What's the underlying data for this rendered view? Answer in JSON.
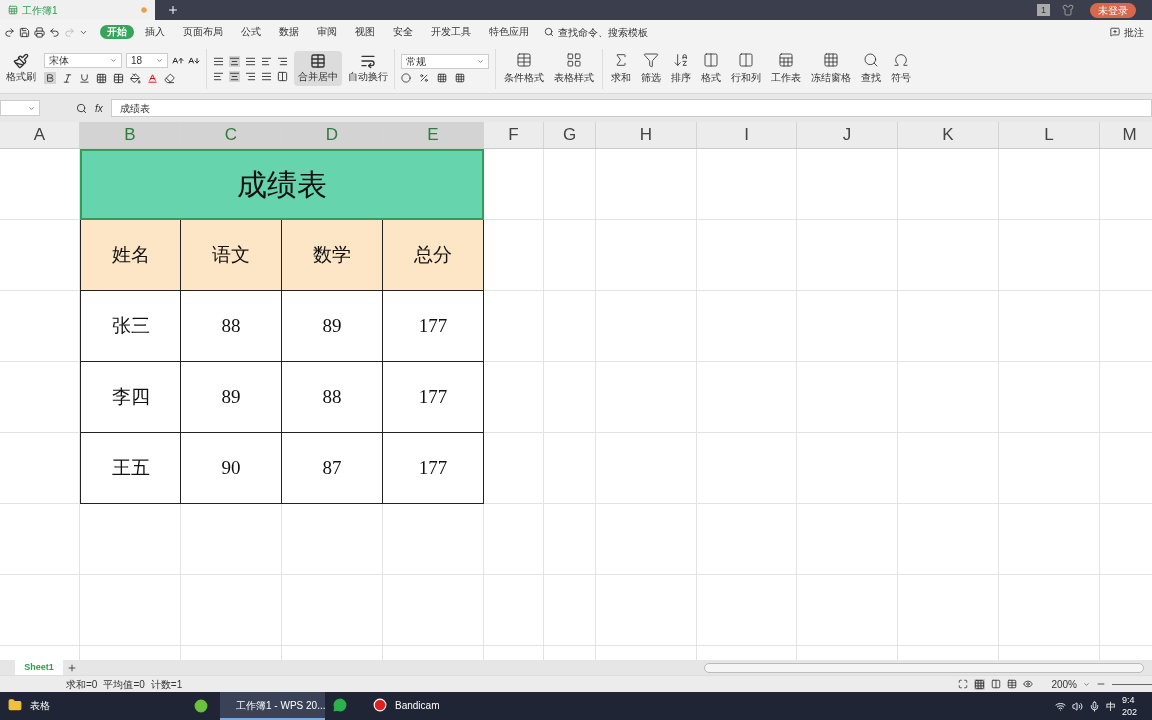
{
  "title_bar": {
    "tabs": [
      {
        "label": "工作簿1",
        "selected": true
      }
    ],
    "window_count": "1",
    "login": "未登录"
  },
  "menu": {
    "items": [
      {
        "label": "开始",
        "selected": true
      },
      {
        "label": "插入",
        "selected": false
      },
      {
        "label": "页面布局",
        "selected": false
      },
      {
        "label": "公式",
        "selected": false
      },
      {
        "label": "数据",
        "selected": false
      },
      {
        "label": "审阅",
        "selected": false
      },
      {
        "label": "视图",
        "selected": false
      },
      {
        "label": "安全",
        "selected": false
      },
      {
        "label": "开发工具",
        "selected": false
      },
      {
        "label": "特色应用",
        "selected": false
      }
    ],
    "search": "查找命令、搜索模板",
    "comment": "批注"
  },
  "ribbon": {
    "format_painter": "格式刷",
    "font_name": "宋体",
    "font_size": "18",
    "bold": true,
    "align_center": true,
    "merge": "合并居中",
    "wrap": "自动换行",
    "number_format": "常规",
    "tools": [
      {
        "kind": "cond",
        "label": "条件格式"
      },
      {
        "kind": "style",
        "label": "表格样式"
      },
      {
        "kind": "sum",
        "label": "求和"
      },
      {
        "kind": "filter",
        "label": "筛选"
      },
      {
        "kind": "sort",
        "label": "排序"
      },
      {
        "kind": "format",
        "label": "格式"
      },
      {
        "kind": "rowcol",
        "label": "行和列"
      },
      {
        "kind": "sheet",
        "label": "工作表"
      },
      {
        "kind": "freeze",
        "label": "冻结窗格"
      },
      {
        "kind": "find",
        "label": "查找"
      },
      {
        "kind": "symbol",
        "label": "符号"
      }
    ]
  },
  "formula_bar": {
    "fx": "fx",
    "value": "成绩表"
  },
  "columns": [
    {
      "label": "A",
      "selected": false
    },
    {
      "label": "B",
      "selected": true
    },
    {
      "label": "C",
      "selected": true
    },
    {
      "label": "D",
      "selected": true
    },
    {
      "label": "E",
      "selected": true
    },
    {
      "label": "F",
      "selected": false
    },
    {
      "label": "G",
      "selected": false
    },
    {
      "label": "H",
      "selected": false
    },
    {
      "label": "I",
      "selected": false
    },
    {
      "label": "J",
      "selected": false
    },
    {
      "label": "K",
      "selected": false
    },
    {
      "label": "L",
      "selected": false
    },
    {
      "label": "M",
      "selected": false
    }
  ],
  "table": {
    "title": "成绩表",
    "headers": [
      "姓名",
      "语文",
      "数学",
      "总分"
    ],
    "rows": [
      [
        "张三",
        "88",
        "89",
        "177"
      ],
      [
        "李四",
        "89",
        "88",
        "177"
      ],
      [
        "王五",
        "90",
        "87",
        "177"
      ]
    ]
  },
  "sheet_tabs": [
    {
      "label": "Sheet1",
      "selected": true
    }
  ],
  "status_bar": {
    "stats": [
      "求和=0",
      "平均值=0",
      "计数=1"
    ],
    "zoom": "200%"
  },
  "taskbar": {
    "items": [
      {
        "kind": "folder",
        "label": "表格",
        "active": false
      },
      {
        "kind": "wps",
        "label": "工作簿1 - WPS 20...",
        "active": true
      },
      {
        "kind": "chat",
        "active": false
      },
      {
        "kind": "record",
        "label": "Bandicam",
        "active": false
      }
    ],
    "ime": "中",
    "clock": [
      "9:4",
      "202"
    ]
  }
}
